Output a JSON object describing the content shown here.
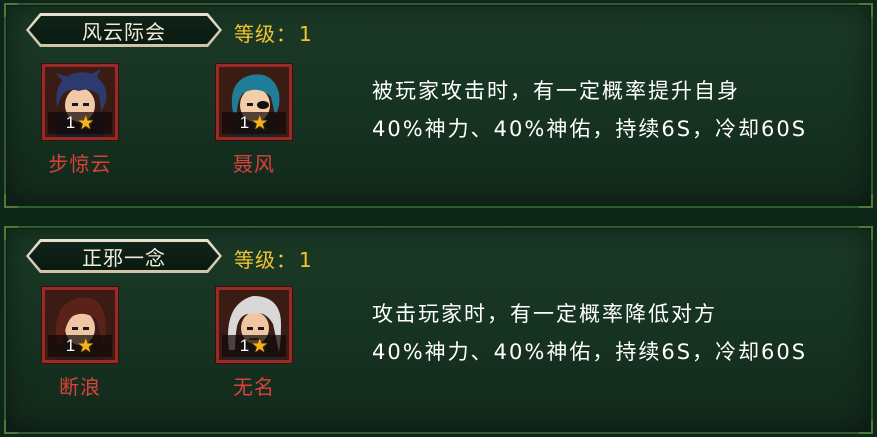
{
  "panels": [
    {
      "title": "风云际会",
      "level_label": "等级：",
      "level_value": "1",
      "heroes": [
        {
          "name": "步惊云",
          "level": "1",
          "hair": "#2c3a6e",
          "skin": "#f0c9a6"
        },
        {
          "name": "聂风",
          "level": "1",
          "hair": "#1f7d97",
          "skin": "#f1cda9"
        }
      ],
      "description": [
        "被玩家攻击时，有一定概率提升自身",
        "40%神力、40%神佑，持续6S，冷却60S"
      ]
    },
    {
      "title": "正邪一念",
      "level_label": "等级：",
      "level_value": "1",
      "heroes": [
        {
          "name": "断浪",
          "level": "1",
          "hair": "#5a2218",
          "skin": "#f0c6a2"
        },
        {
          "name": "无名",
          "level": "1",
          "hair": "#d8d8d8",
          "skin": "#f0c6a2"
        }
      ],
      "description": [
        "攻击玩家时，有一定概率降低对方",
        "40%神力、40%神佑，持续6S，冷却60S"
      ]
    }
  ],
  "colors": {
    "level_text": "#f1c52f",
    "hero_name": "#d9413a",
    "portrait_border": "#9a2a26",
    "star": "#f4b319"
  },
  "icons": {
    "star": "★"
  }
}
